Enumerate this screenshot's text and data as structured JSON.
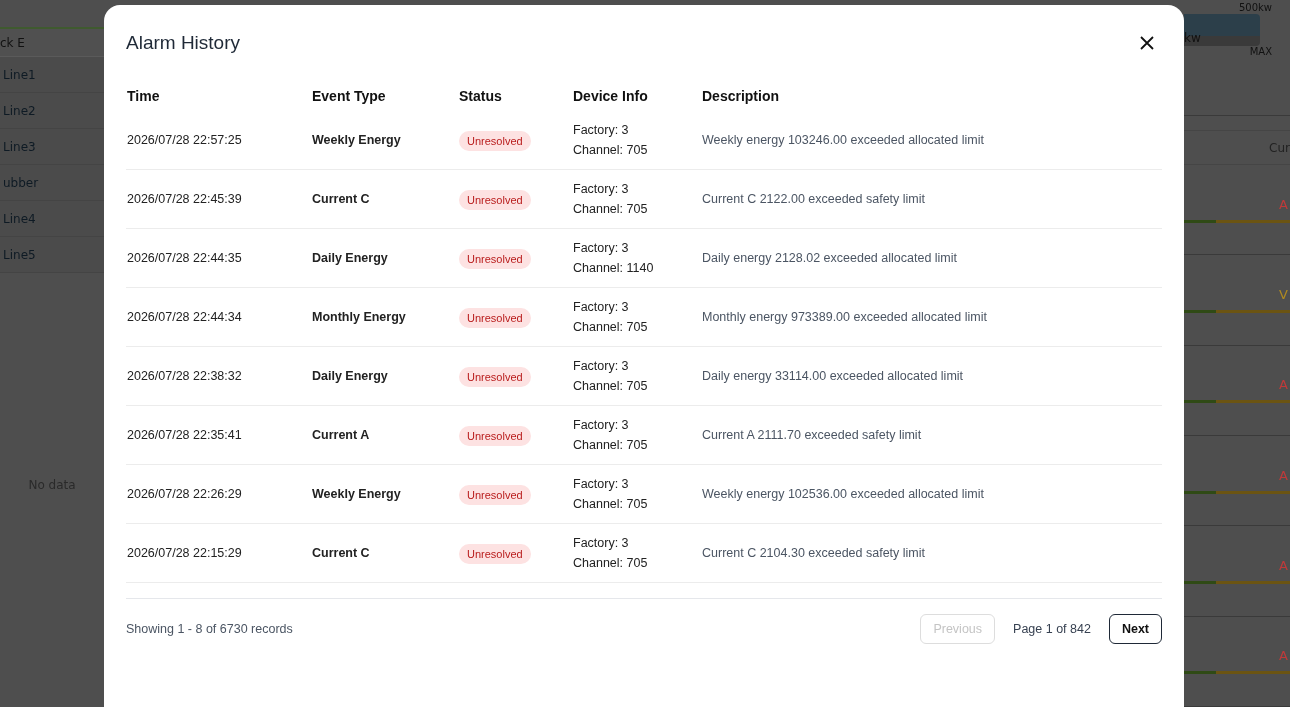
{
  "background": {
    "sidebar": {
      "header": "ck E",
      "items": [
        "Line1",
        "Line2",
        "Line3",
        "ubber",
        "Line4",
        "Line5"
      ],
      "empty": "No data"
    },
    "right_panel": {
      "max_value": "500kw",
      "bar_value": "kw",
      "max_label": "MAX",
      "column": "Cur",
      "rows": [
        {
          "label": "A",
          "color": "#c03a3a"
        },
        {
          "label": "V",
          "color": "#b08a20"
        },
        {
          "label": "A",
          "color": "#c03a3a"
        },
        {
          "label": "A",
          "color": "#c03a3a"
        },
        {
          "label": "A",
          "color": "#c03a3a"
        },
        {
          "label": "A",
          "color": "#c03a3a"
        }
      ]
    }
  },
  "dialog": {
    "title": "Alarm History",
    "columns": [
      "Time",
      "Event Type",
      "Status",
      "Device Info",
      "Description"
    ],
    "rows": [
      {
        "time": "2026/07/28 22:57:25",
        "event": "Weekly Energy",
        "status": "Unresolved",
        "factory": "Factory: 3",
        "channel": "Channel: 705",
        "description": "Weekly energy 103246.00 exceeded allocated limit"
      },
      {
        "time": "2026/07/28 22:45:39",
        "event": "Current C",
        "status": "Unresolved",
        "factory": "Factory: 3",
        "channel": "Channel: 705",
        "description": "Current C 2122.00 exceeded safety limit"
      },
      {
        "time": "2026/07/28 22:44:35",
        "event": "Daily Energy",
        "status": "Unresolved",
        "factory": "Factory: 3",
        "channel": "Channel: 1140",
        "description": "Daily energy 2128.02 exceeded allocated limit"
      },
      {
        "time": "2026/07/28 22:44:34",
        "event": "Monthly Energy",
        "status": "Unresolved",
        "factory": "Factory: 3",
        "channel": "Channel: 705",
        "description": "Monthly energy 973389.00 exceeded allocated limit"
      },
      {
        "time": "2026/07/28 22:38:32",
        "event": "Daily Energy",
        "status": "Unresolved",
        "factory": "Factory: 3",
        "channel": "Channel: 705",
        "description": "Daily energy 33114.00 exceeded allocated limit"
      },
      {
        "time": "2026/07/28 22:35:41",
        "event": "Current A",
        "status": "Unresolved",
        "factory": "Factory: 3",
        "channel": "Channel: 705",
        "description": "Current A 2111.70 exceeded safety limit"
      },
      {
        "time": "2026/07/28 22:26:29",
        "event": "Weekly Energy",
        "status": "Unresolved",
        "factory": "Factory: 3",
        "channel": "Channel: 705",
        "description": "Weekly energy 102536.00 exceeded allocated limit"
      },
      {
        "time": "2026/07/28 22:15:29",
        "event": "Current C",
        "status": "Unresolved",
        "factory": "Factory: 3",
        "channel": "Channel: 705",
        "description": "Current C 2104.30 exceeded safety limit"
      }
    ],
    "summary": "Showing 1 - 8 of 6730 records",
    "pagination": {
      "previous": {
        "label": "Previous",
        "disabled": true
      },
      "page": "Page 1 of 842",
      "next": {
        "label": "Next",
        "disabled": false
      }
    }
  }
}
